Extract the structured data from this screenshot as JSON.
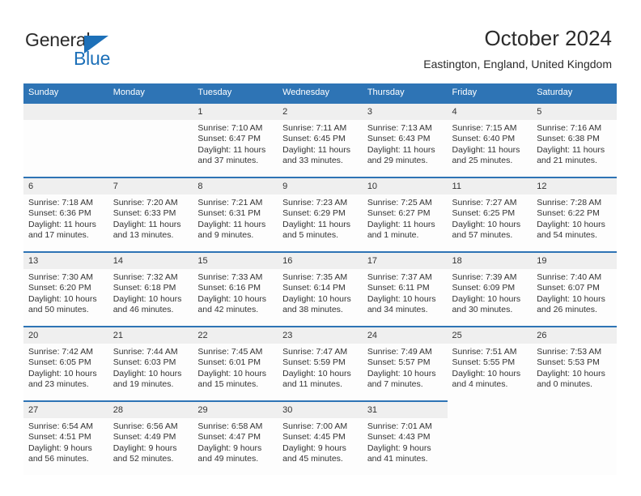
{
  "brand": {
    "name_part1": "General",
    "name_part2": "Blue",
    "accent_color": "#1d70b8"
  },
  "header": {
    "title": "October 2024",
    "subtitle": "Eastington, England, United Kingdom"
  },
  "theme": {
    "header_blue": "#2e74b5",
    "daynum_band": "#efefef",
    "text": "#333333"
  },
  "weekday_headers": [
    "Sunday",
    "Monday",
    "Tuesday",
    "Wednesday",
    "Thursday",
    "Friday",
    "Saturday"
  ],
  "labels": {
    "sunrise_prefix": "Sunrise:",
    "sunset_prefix": "Sunset:",
    "daylight_prefix": "Daylight:"
  },
  "weeks": [
    [
      {
        "day": "",
        "blank": true
      },
      {
        "day": "",
        "blank": true
      },
      {
        "day": "1",
        "sunrise": "Sunrise: 7:10 AM",
        "sunset": "Sunset: 6:47 PM",
        "daylight1": "Daylight: 11 hours",
        "daylight2": "and 37 minutes."
      },
      {
        "day": "2",
        "sunrise": "Sunrise: 7:11 AM",
        "sunset": "Sunset: 6:45 PM",
        "daylight1": "Daylight: 11 hours",
        "daylight2": "and 33 minutes."
      },
      {
        "day": "3",
        "sunrise": "Sunrise: 7:13 AM",
        "sunset": "Sunset: 6:43 PM",
        "daylight1": "Daylight: 11 hours",
        "daylight2": "and 29 minutes."
      },
      {
        "day": "4",
        "sunrise": "Sunrise: 7:15 AM",
        "sunset": "Sunset: 6:40 PM",
        "daylight1": "Daylight: 11 hours",
        "daylight2": "and 25 minutes."
      },
      {
        "day": "5",
        "sunrise": "Sunrise: 7:16 AM",
        "sunset": "Sunset: 6:38 PM",
        "daylight1": "Daylight: 11 hours",
        "daylight2": "and 21 minutes."
      }
    ],
    [
      {
        "day": "6",
        "sunrise": "Sunrise: 7:18 AM",
        "sunset": "Sunset: 6:36 PM",
        "daylight1": "Daylight: 11 hours",
        "daylight2": "and 17 minutes."
      },
      {
        "day": "7",
        "sunrise": "Sunrise: 7:20 AM",
        "sunset": "Sunset: 6:33 PM",
        "daylight1": "Daylight: 11 hours",
        "daylight2": "and 13 minutes."
      },
      {
        "day": "8",
        "sunrise": "Sunrise: 7:21 AM",
        "sunset": "Sunset: 6:31 PM",
        "daylight1": "Daylight: 11 hours",
        "daylight2": "and 9 minutes."
      },
      {
        "day": "9",
        "sunrise": "Sunrise: 7:23 AM",
        "sunset": "Sunset: 6:29 PM",
        "daylight1": "Daylight: 11 hours",
        "daylight2": "and 5 minutes."
      },
      {
        "day": "10",
        "sunrise": "Sunrise: 7:25 AM",
        "sunset": "Sunset: 6:27 PM",
        "daylight1": "Daylight: 11 hours",
        "daylight2": "and 1 minute."
      },
      {
        "day": "11",
        "sunrise": "Sunrise: 7:27 AM",
        "sunset": "Sunset: 6:25 PM",
        "daylight1": "Daylight: 10 hours",
        "daylight2": "and 57 minutes."
      },
      {
        "day": "12",
        "sunrise": "Sunrise: 7:28 AM",
        "sunset": "Sunset: 6:22 PM",
        "daylight1": "Daylight: 10 hours",
        "daylight2": "and 54 minutes."
      }
    ],
    [
      {
        "day": "13",
        "sunrise": "Sunrise: 7:30 AM",
        "sunset": "Sunset: 6:20 PM",
        "daylight1": "Daylight: 10 hours",
        "daylight2": "and 50 minutes."
      },
      {
        "day": "14",
        "sunrise": "Sunrise: 7:32 AM",
        "sunset": "Sunset: 6:18 PM",
        "daylight1": "Daylight: 10 hours",
        "daylight2": "and 46 minutes."
      },
      {
        "day": "15",
        "sunrise": "Sunrise: 7:33 AM",
        "sunset": "Sunset: 6:16 PM",
        "daylight1": "Daylight: 10 hours",
        "daylight2": "and 42 minutes."
      },
      {
        "day": "16",
        "sunrise": "Sunrise: 7:35 AM",
        "sunset": "Sunset: 6:14 PM",
        "daylight1": "Daylight: 10 hours",
        "daylight2": "and 38 minutes."
      },
      {
        "day": "17",
        "sunrise": "Sunrise: 7:37 AM",
        "sunset": "Sunset: 6:11 PM",
        "daylight1": "Daylight: 10 hours",
        "daylight2": "and 34 minutes."
      },
      {
        "day": "18",
        "sunrise": "Sunrise: 7:39 AM",
        "sunset": "Sunset: 6:09 PM",
        "daylight1": "Daylight: 10 hours",
        "daylight2": "and 30 minutes."
      },
      {
        "day": "19",
        "sunrise": "Sunrise: 7:40 AM",
        "sunset": "Sunset: 6:07 PM",
        "daylight1": "Daylight: 10 hours",
        "daylight2": "and 26 minutes."
      }
    ],
    [
      {
        "day": "20",
        "sunrise": "Sunrise: 7:42 AM",
        "sunset": "Sunset: 6:05 PM",
        "daylight1": "Daylight: 10 hours",
        "daylight2": "and 23 minutes."
      },
      {
        "day": "21",
        "sunrise": "Sunrise: 7:44 AM",
        "sunset": "Sunset: 6:03 PM",
        "daylight1": "Daylight: 10 hours",
        "daylight2": "and 19 minutes."
      },
      {
        "day": "22",
        "sunrise": "Sunrise: 7:45 AM",
        "sunset": "Sunset: 6:01 PM",
        "daylight1": "Daylight: 10 hours",
        "daylight2": "and 15 minutes."
      },
      {
        "day": "23",
        "sunrise": "Sunrise: 7:47 AM",
        "sunset": "Sunset: 5:59 PM",
        "daylight1": "Daylight: 10 hours",
        "daylight2": "and 11 minutes."
      },
      {
        "day": "24",
        "sunrise": "Sunrise: 7:49 AM",
        "sunset": "Sunset: 5:57 PM",
        "daylight1": "Daylight: 10 hours",
        "daylight2": "and 7 minutes."
      },
      {
        "day": "25",
        "sunrise": "Sunrise: 7:51 AM",
        "sunset": "Sunset: 5:55 PM",
        "daylight1": "Daylight: 10 hours",
        "daylight2": "and 4 minutes."
      },
      {
        "day": "26",
        "sunrise": "Sunrise: 7:53 AM",
        "sunset": "Sunset: 5:53 PM",
        "daylight1": "Daylight: 10 hours",
        "daylight2": "and 0 minutes."
      }
    ],
    [
      {
        "day": "27",
        "sunrise": "Sunrise: 6:54 AM",
        "sunset": "Sunset: 4:51 PM",
        "daylight1": "Daylight: 9 hours",
        "daylight2": "and 56 minutes."
      },
      {
        "day": "28",
        "sunrise": "Sunrise: 6:56 AM",
        "sunset": "Sunset: 4:49 PM",
        "daylight1": "Daylight: 9 hours",
        "daylight2": "and 52 minutes."
      },
      {
        "day": "29",
        "sunrise": "Sunrise: 6:58 AM",
        "sunset": "Sunset: 4:47 PM",
        "daylight1": "Daylight: 9 hours",
        "daylight2": "and 49 minutes."
      },
      {
        "day": "30",
        "sunrise": "Sunrise: 7:00 AM",
        "sunset": "Sunset: 4:45 PM",
        "daylight1": "Daylight: 9 hours",
        "daylight2": "and 45 minutes."
      },
      {
        "day": "31",
        "sunrise": "Sunrise: 7:01 AM",
        "sunset": "Sunset: 4:43 PM",
        "daylight1": "Daylight: 9 hours",
        "daylight2": "and 41 minutes."
      },
      {
        "day": "",
        "trailing": true
      },
      {
        "day": "",
        "trailing": true
      }
    ]
  ]
}
